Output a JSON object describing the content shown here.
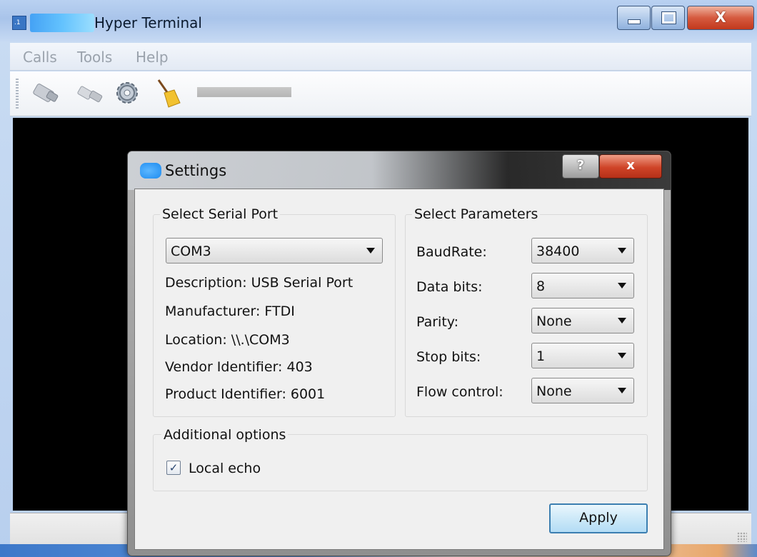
{
  "window": {
    "title": "Hyper Terminal",
    "close_glyph": "X"
  },
  "menubar": {
    "items": [
      "Calls",
      "Tools",
      "Help"
    ]
  },
  "toolbar": {
    "icons": [
      "connect-icon",
      "disconnect-icon",
      "settings-icon",
      "clear-icon"
    ]
  },
  "dialog": {
    "title": "Settings",
    "help_label": "?",
    "close_label": "x",
    "serial_port": {
      "group_title": "Select Serial Port",
      "selected": "COM3",
      "description": "Description: USB Serial Port",
      "manufacturer": "Manufacturer: FTDI",
      "location": "Location: \\\\.\\COM3",
      "vendor": "Vendor Identifier: 403",
      "product": "Product Identifier: 6001"
    },
    "parameters": {
      "group_title": "Select Parameters",
      "baud_label": "BaudRate:",
      "baud_value": "38400",
      "data_bits_label": "Data bits:",
      "data_bits_value": "8",
      "parity_label": "Parity:",
      "parity_value": "None",
      "stop_bits_label": "Stop bits:",
      "stop_bits_value": "1",
      "flow_label": "Flow control:",
      "flow_value": "None"
    },
    "additional": {
      "group_title": "Additional options",
      "local_echo_label": "Local echo",
      "local_echo_checked": true,
      "check_glyph": "✓"
    },
    "apply_label": "Apply"
  },
  "colors": {
    "terminal_bg": "#000000",
    "apply_border": "#3c7fb1",
    "close_red": "#cf4428"
  }
}
